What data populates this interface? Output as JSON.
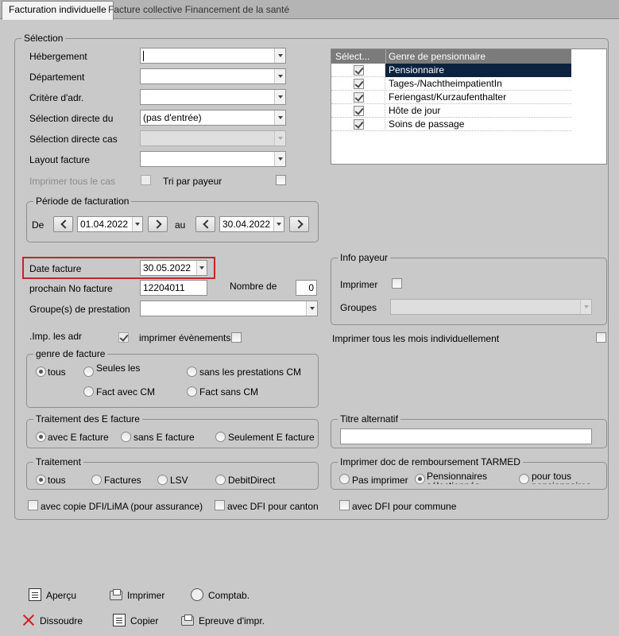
{
  "tabs": [
    {
      "label": "Facturation individuelle",
      "active": true
    },
    {
      "label": "Facture collective Financement de la santé",
      "active": false
    }
  ],
  "selection": {
    "legend": "Sélection",
    "hebergement": {
      "label": "Hébergement",
      "value": ""
    },
    "departement": {
      "label": "Département",
      "value": ""
    },
    "critere": {
      "label": "Critère d'adr.",
      "value": ""
    },
    "selection_directe_du": {
      "label": "Sélection directe du",
      "value": "(pas d'entrée)"
    },
    "selection_directe_cas": {
      "label": "Sélection directe cas",
      "value": ""
    },
    "layout_facture": {
      "label": "Layout facture",
      "value": ""
    },
    "imprimer_tous_cas": {
      "label": "Imprimer tous le cas",
      "checked": false
    },
    "tri_par_payeur": {
      "label": "Tri par payeur",
      "checked": false
    }
  },
  "grid": {
    "col1": "Sélect...",
    "col2": "Genre de pensionnaire",
    "rows": [
      {
        "label": "Pensionnaire",
        "checked": true,
        "selected": true
      },
      {
        "label": "Tages-/NachtheimpatientIn",
        "checked": true,
        "selected": false
      },
      {
        "label": "Feriengast/Kurzaufenthalter",
        "checked": true,
        "selected": false
      },
      {
        "label": "Hôte de jour",
        "checked": true,
        "selected": false
      },
      {
        "label": "Soins de passage",
        "checked": true,
        "selected": false
      }
    ]
  },
  "periode": {
    "legend": "Période de facturation",
    "de_label": "De",
    "de_value": "01.04.2022",
    "au_label": "au",
    "au_value": "30.04.2022"
  },
  "date_facture": {
    "label": "Date facture",
    "value": "30.05.2022"
  },
  "prochain_no": {
    "label": "prochain No facture",
    "value": "12204011"
  },
  "nombre_de": {
    "label": "Nombre de",
    "value": "0"
  },
  "groupes_prestation": {
    "label": "Groupe(s) de prestation",
    "value": ""
  },
  "imp_adr": {
    "label": ".Imp. les adr",
    "checked": true
  },
  "imprimer_evenements": {
    "label": "imprimer évènements",
    "checked": false
  },
  "info_payeur": {
    "legend": "Info payeur",
    "imprimer_label": "Imprimer",
    "imprimer_checked": false,
    "groupes_label": "Groupes",
    "groupes_value": ""
  },
  "imprimer_tous_mois": {
    "label": "Imprimer tous les mois individuellement",
    "checked": false
  },
  "genre_facture": {
    "legend": "genre de facture",
    "options": [
      "tous",
      "Seules les prestations CM",
      "sans les prestations CM",
      "Fact avec CM",
      "Fact sans CM"
    ],
    "selected": "tous"
  },
  "traitement_efacture": {
    "legend": "Traitement des E facture",
    "options": [
      "avec E facture",
      "sans E facture",
      "Seulement E facture"
    ],
    "selected": "avec E facture"
  },
  "titre_alternatif": {
    "legend": "Titre alternatif",
    "value": ""
  },
  "traitement": {
    "legend": "Traitement",
    "options": [
      "tous",
      "Factures",
      "LSV",
      "DebitDirect"
    ],
    "selected": "tous"
  },
  "tarmed": {
    "legend": "Imprimer doc de remboursement TARMED",
    "options": [
      "Pas imprimer",
      "Pensionnaires sélectionnés",
      "pour tous pensionnaires"
    ],
    "selected": "Pensionnaires sélectionnés"
  },
  "copies": {
    "dfi_lima": "avec copie DFI/LiMA (pour assurance)",
    "dfi_canton": "avec DFI pour canton",
    "dfi_commune": "avec DFI pour commune"
  },
  "toolbar": {
    "apercu": "Aperçu",
    "imprimer": "Imprimer",
    "comptab": "Comptab.",
    "dissoudre": "Dissoudre",
    "copier": "Copier",
    "epreuve": "Epreuve d'impr."
  },
  "colors": {
    "accent_highlight": "#c0272d",
    "grid_selected": "#0c2340",
    "grid_header": "#7b7b7b"
  }
}
